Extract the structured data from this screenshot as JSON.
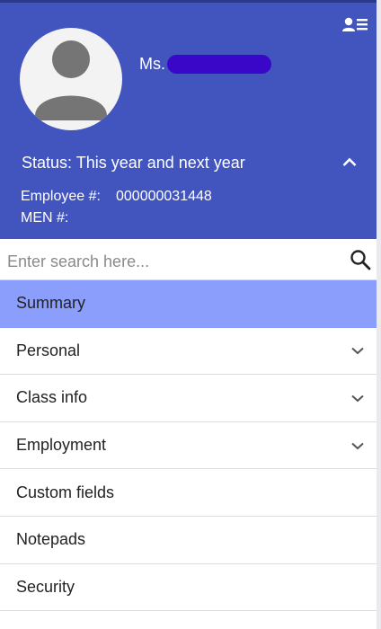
{
  "profile": {
    "salutation": "Ms.",
    "status_label": "Status: This year and next year",
    "employee_label": "Employee #:",
    "employee_value": "000000031448",
    "men_label": "MEN #:",
    "men_value": ""
  },
  "search": {
    "placeholder": "Enter search here..."
  },
  "menu": {
    "items": [
      {
        "label": "Summary",
        "active": true,
        "expandable": false
      },
      {
        "label": "Personal",
        "active": false,
        "expandable": true
      },
      {
        "label": "Class info",
        "active": false,
        "expandable": true
      },
      {
        "label": "Employment",
        "active": false,
        "expandable": true
      },
      {
        "label": "Custom fields",
        "active": false,
        "expandable": false
      },
      {
        "label": "Notepads",
        "active": false,
        "expandable": false
      },
      {
        "label": "Security",
        "active": false,
        "expandable": false
      }
    ]
  },
  "colors": {
    "header_bg": "#4255be",
    "active_item_bg": "#8c9efc",
    "redaction": "#3a06c8"
  },
  "icons": {
    "contact": "contact-card-icon",
    "avatar": "person-silhouette-icon",
    "collapse": "chevron-up-icon",
    "search": "search-icon",
    "expand": "chevron-down-icon"
  }
}
